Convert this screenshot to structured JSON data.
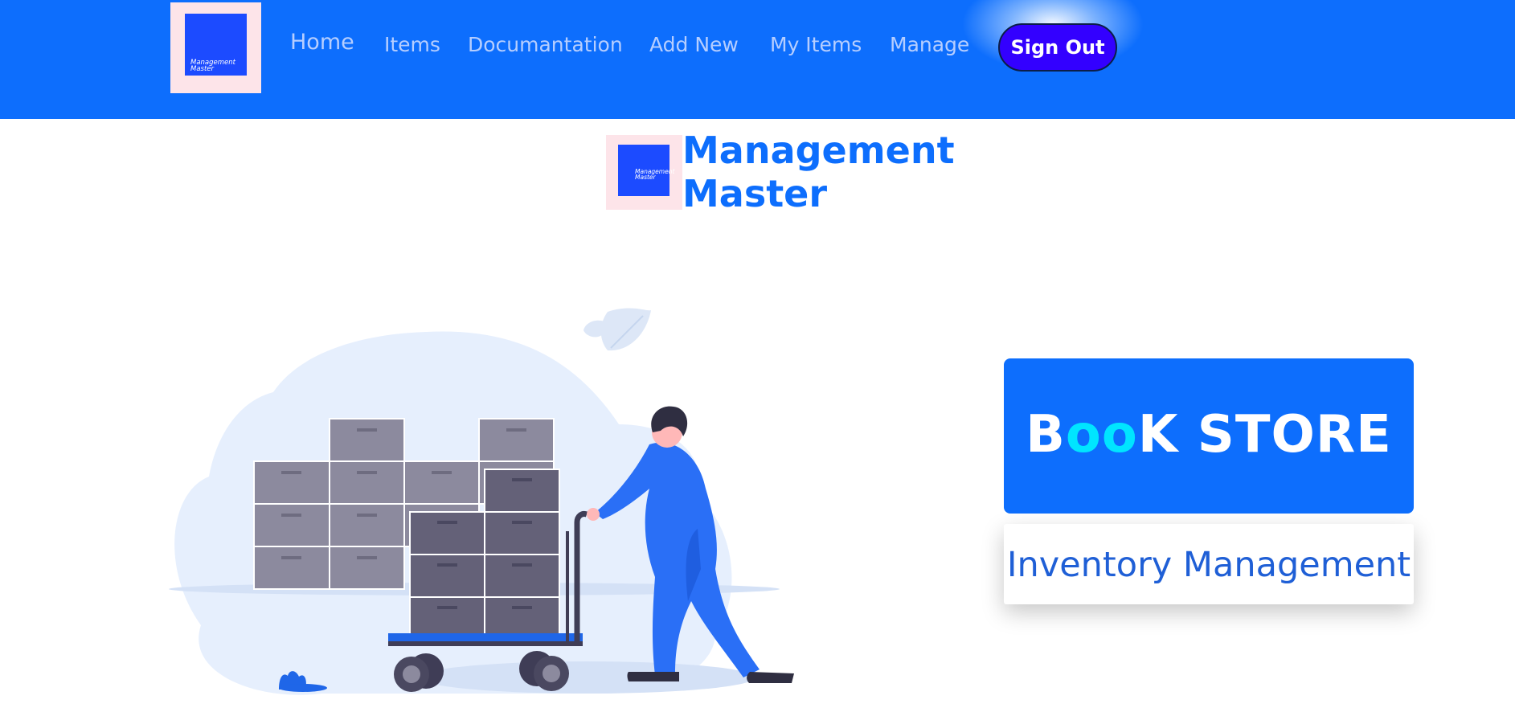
{
  "nav": {
    "logo_text_line1": "Management",
    "logo_text_line2": "Master",
    "links": [
      {
        "label": "Home"
      },
      {
        "label": "Items"
      },
      {
        "label": "Documantation"
      },
      {
        "label": "Add New"
      },
      {
        "label": "My Items"
      },
      {
        "label": "Manage"
      }
    ],
    "signout_label": "Sign Out"
  },
  "brand": {
    "title_line1": "Management",
    "title_line2": "Master"
  },
  "hero": {
    "illustration": "worker-pushing-cart-with-boxes"
  },
  "store": {
    "title_part1": "B",
    "title_part2": "oo",
    "title_part3": "K STORE",
    "subtitle": "Inventory Management"
  },
  "colors": {
    "primary": "#0d6efd",
    "signout": "#3300ff",
    "accent_cyan": "#00e5ff",
    "logo_bg": "#fde4e9",
    "logo_square": "#1c4bff"
  }
}
